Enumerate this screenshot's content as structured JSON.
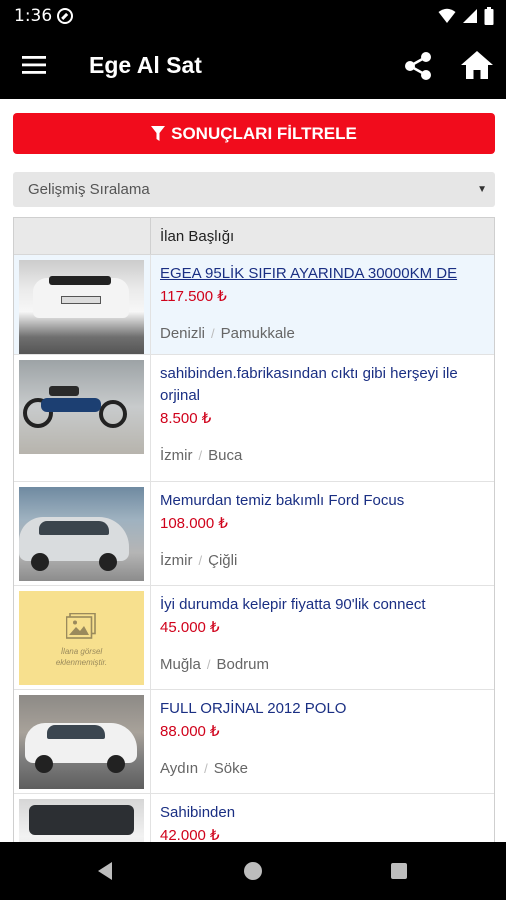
{
  "status_bar": {
    "time": "1:36"
  },
  "app_bar": {
    "title": "Ege Al Sat"
  },
  "filter_button": {
    "label": "SONUÇLARI FİLTRELE"
  },
  "sort_select": {
    "selected": "Gelişmiş Sıralama"
  },
  "table": {
    "header_title": "İlan Başlığı",
    "listings": [
      {
        "title": "EGEA 95LİK SIFIR AYARINDA 30000KM DE",
        "price": "117.500 ₺",
        "city": "Denizli",
        "district": "Pamukkale"
      },
      {
        "title": "sahibinden.fabrikasından cıktı gibi herşeyi ile orjinal",
        "price": "8.500 ₺",
        "city": "İzmir",
        "district": "Buca"
      },
      {
        "title": "Memurdan temiz bakımlı Ford Focus",
        "price": "108.000 ₺",
        "city": "İzmir",
        "district": "Çiğli"
      },
      {
        "title": "İyi durumda kelepir fiyatta 90'lik connect",
        "price": "45.000 ₺",
        "city": "Muğla",
        "district": "Bodrum",
        "placeholder_text": "İlana görsel eklenmemiştir."
      },
      {
        "title": "FULL ORJİNAL 2012 POLO",
        "price": "88.000 ₺",
        "city": "Aydın",
        "district": "Söke"
      },
      {
        "title": "Sahibinden",
        "price": "42.000 ₺"
      }
    ]
  },
  "colors": {
    "accent_red": "#f10c1c",
    "title_blue": "#1a2f83",
    "price_red": "#d0021b",
    "bar_black": "#000000"
  }
}
